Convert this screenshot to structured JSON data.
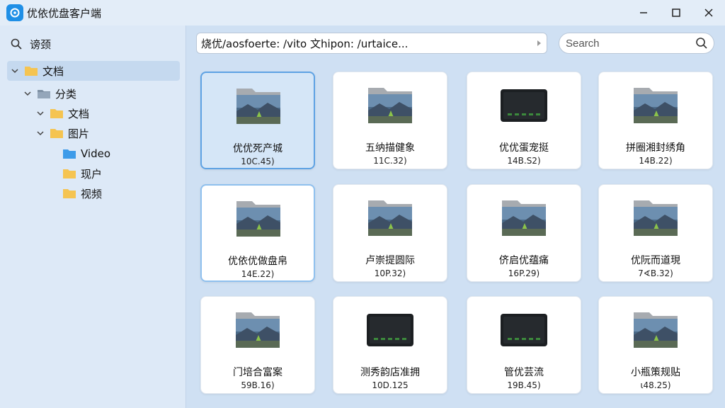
{
  "window": {
    "title": "优依优盘客户端",
    "controls": {
      "minimize": "—",
      "maximize": "☐",
      "close": "✕"
    }
  },
  "sidebar": {
    "search_label": "谤颈",
    "tree": [
      {
        "label": "文档",
        "level": 0,
        "expanded": true,
        "selected": true,
        "icon": "folder-icon"
      },
      {
        "label": "分类",
        "level": 1,
        "expanded": true,
        "selected": false,
        "icon": "drive-icon"
      },
      {
        "label": "文档",
        "level": 2,
        "expanded": true,
        "selected": false,
        "icon": "folder-icon"
      },
      {
        "label": "图片",
        "level": 2,
        "expanded": true,
        "selected": false,
        "icon": "folder-icon"
      },
      {
        "label": "Video",
        "level": 3,
        "expanded": false,
        "selected": false,
        "icon": "folder-blue-icon"
      },
      {
        "label": "现户",
        "level": 3,
        "expanded": false,
        "selected": false,
        "icon": "folder-icon"
      },
      {
        "label": "视频",
        "level": 3,
        "expanded": false,
        "selected": false,
        "icon": "folder-icon"
      }
    ]
  },
  "toolbar": {
    "path": "烧优/aosfoerte: /vito 文hipon: /urtaice...",
    "search_placeholder": "Search"
  },
  "files": [
    {
      "name": "优优死产城",
      "size": "10C.45)",
      "kind": "photo",
      "state": "selected"
    },
    {
      "name": "五纳描健象",
      "size": "11C.32)",
      "kind": "photo",
      "state": ""
    },
    {
      "name": "优优蛋宠挺",
      "size": "14B.S2)",
      "kind": "device",
      "state": ""
    },
    {
      "name": "拼圈湘封绣角",
      "size": "14B.22)",
      "kind": "photo",
      "state": ""
    },
    {
      "name": "优依优做盘帛",
      "size": "14E.22)",
      "kind": "photo",
      "state": "focus"
    },
    {
      "name": "卢崇提圆际",
      "size": "10P.32)",
      "kind": "photo",
      "state": ""
    },
    {
      "name": "侪启优蕴痛",
      "size": "16P.29)",
      "kind": "photo",
      "state": ""
    },
    {
      "name": "优阮而道現",
      "size": "7∢B.32)",
      "kind": "photo",
      "state": ""
    },
    {
      "name": "门培合富案",
      "size": "59B.16)",
      "kind": "photo",
      "state": ""
    },
    {
      "name": "测秀韵店准拥",
      "size": "10D.125",
      "kind": "device",
      "state": ""
    },
    {
      "name": "管优芸流",
      "size": "19B.45)",
      "kind": "device",
      "state": ""
    },
    {
      "name": "小瓶策规贴",
      "size": "ι48.25)",
      "kind": "photo",
      "state": ""
    }
  ],
  "colors": {
    "accent": "#1f8fe6",
    "selection": "#5ea2e3",
    "folder": "#f5c451"
  }
}
